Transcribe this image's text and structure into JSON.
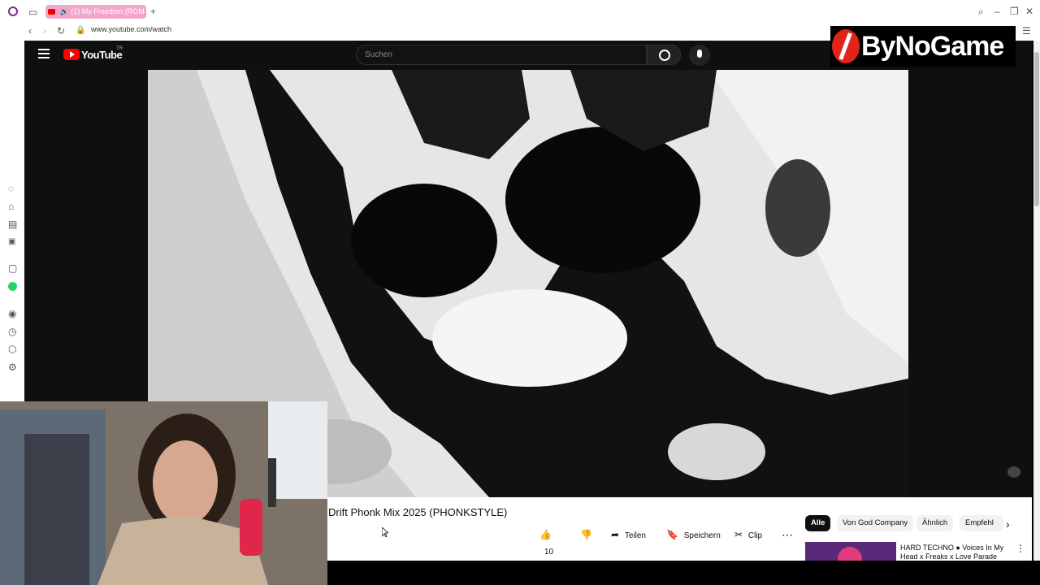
{
  "browser": {
    "tab_title": "(1) My Freedom (ROM",
    "url": "www.youtube.com/watch"
  },
  "youtube": {
    "logo_text": "YouTube",
    "country_code": "TR",
    "search_placeholder": "Suchen"
  },
  "video": {
    "title": "Drift Phonk Mix 2025 (PHONKSTYLE)",
    "like_count": "10",
    "share_label": "Teilen",
    "save_label": "Speichern",
    "clip_label": "Clip"
  },
  "filters": [
    "Alle",
    "Von God Company",
    "Ähnlich",
    "Empfehl"
  ],
  "recommendation": {
    "title_line1": "HARD TECHNO ● Voices In My",
    "title_line2": "Head x Freaks x Love Parade"
  },
  "overlay": {
    "brand": "ByNoGame"
  }
}
